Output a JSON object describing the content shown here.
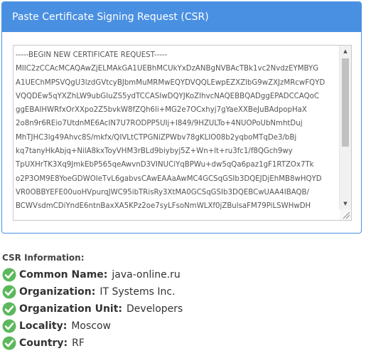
{
  "panel": {
    "title": "Paste Certificate Signing Request (CSR)"
  },
  "csr_lines": [
    "-----BEGIN NEW CERTIFICATE REQUEST-----",
    "MIIC2zCCAcMCAQAwZjELMAkGA1UEBhMCUkYxDzANBgNVBAcTBk1vc2NvdzEYMBYG",
    "A1UEChMPSVQgU3lzdGVtcyBJbmMuMRMwEQYDVQQLEwpEZXZlbG9wZXJzMRcwFQYD",
    "VQQDEw5qYXZhLW9ubGluZS5ydTCCASIwDQYJKoZIhvcNAQEBBQADggEPADCCAQoC",
    "ggEBAIHWRfxOrXXpo2Z5bvkW8fZQh6li+MG2e7OCxhyj7gYaeXXBeJuBAdpopHaX",
    "2o8n9r6REio7UtdnME6AcIN7U7RODPP5UIj+I849/9HZULTo+4NUOPoUbNmhtDuj",
    "MhTJHC3lg49Ahvc8S/mkfx/QIVLtCTPGNiZPWbv78gKLIO08b2yqboMTqDe3/bBj",
    "kq7tanyHkAbjq+NilA8kxToyVHM3rBLd9biybyj5Z+Wn+lt+ru3fc1/f8QGch9wy",
    "TpUXHrTK3Xq9JmkEbP565qeAwvnD3VINUCiYqBPWu+dw5qQa6paz1gF1RTZOx7Tk",
    "o2P3OM9E8YoeGDWOIeTvL6gabvsCAwEAAaAwMC4GCSqGSIb3DQEJDjEhMB8wHQYD",
    "VR0OBBYEFE00uoHVpurqJWC95ibTRisRy3XtMA0GCSqGSIb3DQEBCwUAA4IBAQB/",
    "BCWVsdmCDiYndE6ntnBaxXA5KPz2oe7syLFsoNmWLXf0jZBulsaFM79PiLSWHwDH"
  ],
  "scroll": {
    "position_fraction": 0.0,
    "visible_fraction": 0.55
  },
  "csr_info": {
    "title": "CSR Information:",
    "items": [
      {
        "label": "Common Name:",
        "value": "java-online.ru"
      },
      {
        "label": "Organization:",
        "value": "IT Systems Inc."
      },
      {
        "label": "Organization Unit:",
        "value": "Developers"
      },
      {
        "label": "Locality:",
        "value": "Moscow"
      },
      {
        "label": "Country:",
        "value": "RF"
      }
    ]
  },
  "colors": {
    "panel_header": "#4a90e2",
    "check_green": "#5cb85c"
  },
  "icons": {
    "status": "check-circle-icon",
    "scroll_up": "triangle-up-icon",
    "scroll_down": "triangle-down-icon",
    "resize": "resize-grip-icon"
  }
}
